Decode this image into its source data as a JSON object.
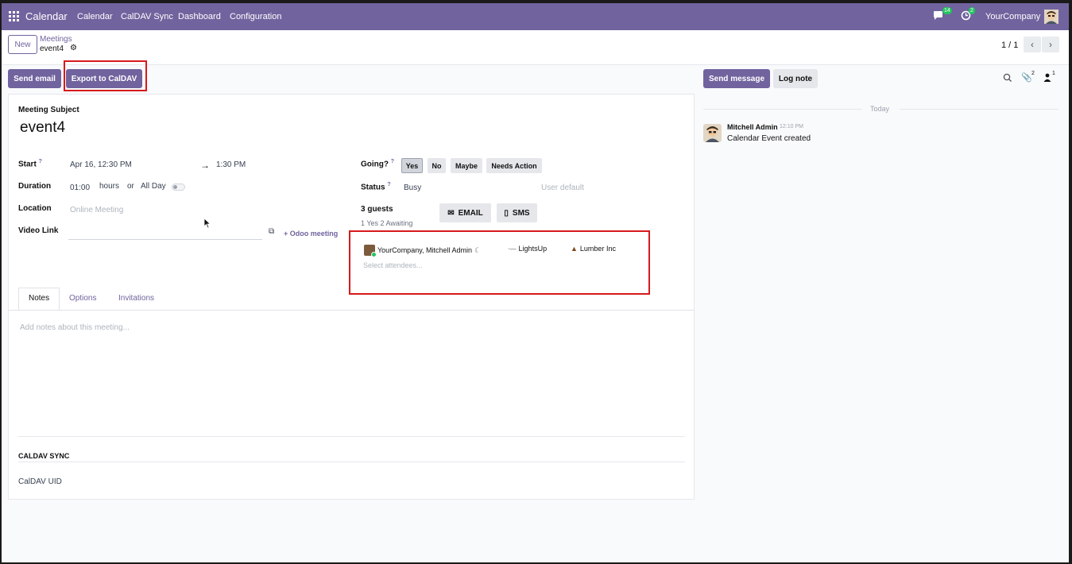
{
  "navbar": {
    "app_name": "Calendar",
    "menu": [
      "Calendar",
      "CalDAV Sync",
      "Dashboard",
      "Configuration"
    ],
    "messages_count": "14",
    "activities_count": "2",
    "company": "YourCompany"
  },
  "control_panel": {
    "new_label": "New",
    "breadcrumb_parent": "Meetings",
    "breadcrumb_current": "event4",
    "pager": "1 / 1"
  },
  "actions": {
    "send_email": "Send email",
    "export_caldav": "Export to CalDAV"
  },
  "form": {
    "subject_label": "Meeting Subject",
    "subject": "event4",
    "start_label": "Start",
    "help_mark": "?",
    "start_value": "Apr 16, 12:30 PM",
    "arrow": "→",
    "end_value": "1:30 PM",
    "duration_label": "Duration",
    "duration_value": "01:00",
    "hours_label": "hours",
    "or_label": "or",
    "allday_label": "All Day",
    "location_label": "Location",
    "location_placeholder": "Online Meeting",
    "videolink_label": "Video Link",
    "odoo_meeting": "+ Odoo meeting",
    "going_label": "Going?",
    "going_options": [
      "Yes",
      "No",
      "Maybe",
      "Needs Action"
    ],
    "status_label": "Status",
    "status_value": "Busy",
    "status_placeholder": "User default",
    "guests_label": "3 guests",
    "guests_summary": "1 Yes  2 Awaiting",
    "email_button": "EMAIL",
    "sms_button": "SMS",
    "attendees": [
      "YourCompany, Mitchell Admin",
      "LightsUp",
      "Lumber Inc"
    ],
    "attendees_placeholder": "Select attendees...",
    "tabs": [
      "Notes",
      "Options",
      "Invitations"
    ],
    "notes_placeholder": "Add notes about this meeting...",
    "caldav_section": "CALDAV SYNC",
    "caldav_uid_label": "CalDAV UID"
  },
  "chatter": {
    "send_message": "Send message",
    "log_note": "Log note",
    "attachments_count": "2",
    "followers_count": "1",
    "date_separator": "Today",
    "message_author": "Mitchell Admin",
    "message_time": "12:10 PM",
    "message_body": "Calendar Event created"
  },
  "colors": {
    "brand": "#71639e",
    "highlight_box": "#d7191c",
    "badge_green": "#22c55e"
  }
}
